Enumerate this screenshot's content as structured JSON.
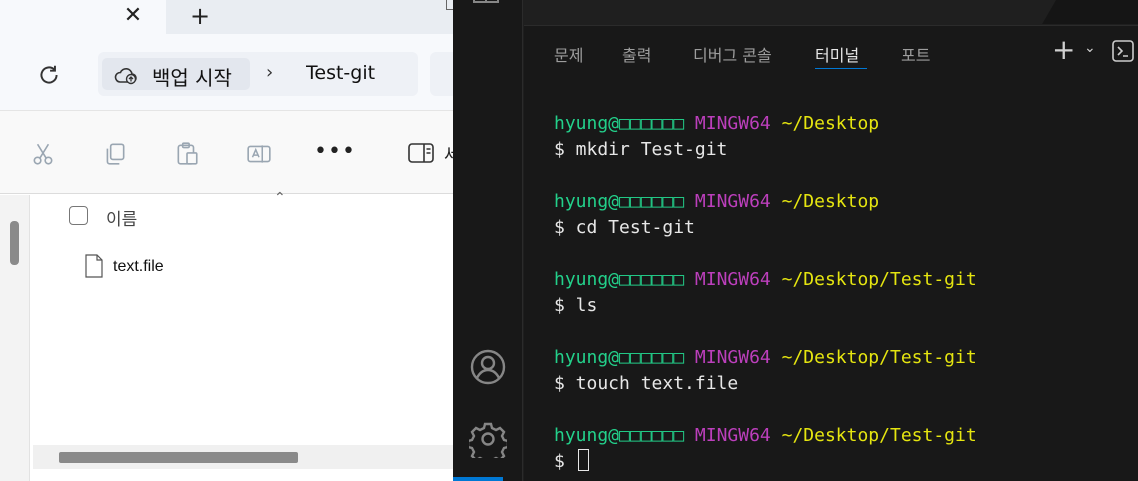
{
  "explorer": {
    "tab": {
      "close_glyph": "✕",
      "new_glyph": "+"
    },
    "address": {
      "home_label": "백업 시작",
      "separator": "›",
      "folder": "Test-git"
    },
    "toolbar": {
      "icons": [
        "cut-icon",
        "copy-icon",
        "paste-icon",
        "rename-icon"
      ],
      "more": "•••",
      "details_label": "세"
    },
    "list": {
      "header_name": "이름",
      "sort_caret": "⌃",
      "files": [
        {
          "name": "text.file"
        }
      ]
    }
  },
  "vscode": {
    "panel_tabs": [
      {
        "label": "문제",
        "active": false
      },
      {
        "label": "출력",
        "active": false
      },
      {
        "label": "디버그 콘솔",
        "active": false
      },
      {
        "label": "터미널",
        "active": true
      },
      {
        "label": "포트",
        "active": false
      }
    ],
    "panel_actions": {
      "plus": "+",
      "chevron": "⌄"
    },
    "terminal": {
      "prompts": [
        {
          "user": "hyung@",
          "host": "□□□□□□",
          "ming": "MINGW64",
          "path": "~/Desktop",
          "command": "$ mkdir Test-git"
        },
        {
          "user": "hyung@",
          "host": "□□□□□□",
          "ming": "MINGW64",
          "path": "~/Desktop",
          "command": "$ cd Test-git"
        },
        {
          "user": "hyung@",
          "host": "□□□□□□",
          "ming": "MINGW64",
          "path": "~/Desktop/Test-git",
          "command": "$ ls"
        },
        {
          "user": "hyung@",
          "host": "□□□□□□",
          "ming": "MINGW64",
          "path": "~/Desktop/Test-git",
          "command": "$ touch text.file"
        },
        {
          "user": "hyung@",
          "host": "□□□□□□",
          "ming": "MINGW64",
          "path": "~/Desktop/Test-git",
          "command": "$ "
        }
      ]
    },
    "colors": {
      "user": "#23d18b",
      "mingw": "#bc3fbc",
      "path": "#e5e510",
      "accent": "#0078d4"
    }
  }
}
